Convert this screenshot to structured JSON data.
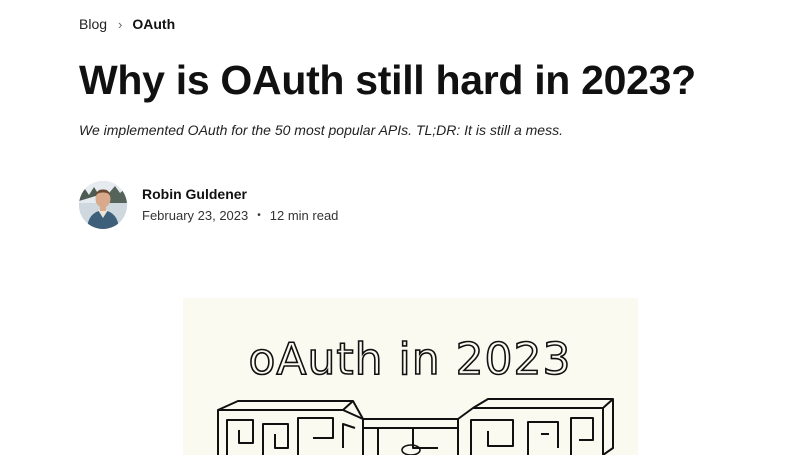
{
  "breadcrumb": {
    "parent_label": "Blog",
    "separator": "›",
    "current_label": "OAuth"
  },
  "article": {
    "title": "Why is OAuth still hard in 2023?",
    "subtitle": "We implemented OAuth for the 50 most popular APIs. TL;DR: It is still a mess.",
    "author_name": "Robin Guldener",
    "date": "February 23, 2023",
    "meta_separator": "•",
    "read_time": "12 min read"
  },
  "hero": {
    "handwritten_title": "oAuth in 2023",
    "background_color": "#fbfaf1",
    "icon": "maze-illustration"
  }
}
